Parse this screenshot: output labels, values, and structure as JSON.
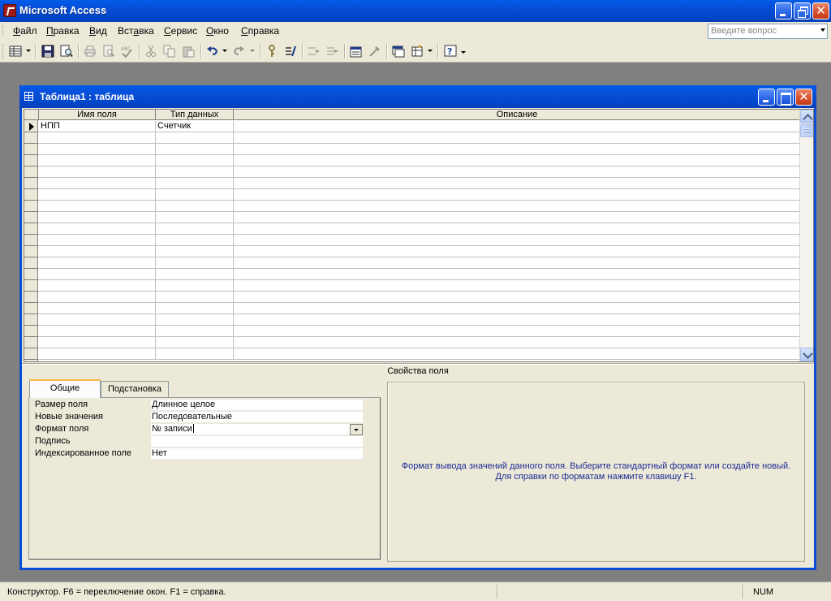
{
  "window": {
    "title": "Microsoft Access"
  },
  "menu": {
    "items": [
      {
        "label": "Файл",
        "accel": "Ф",
        "rest": "айл"
      },
      {
        "label": "Правка",
        "accel": "П",
        "rest": "равка"
      },
      {
        "label": "Вид",
        "accel": "В",
        "rest": "ид"
      },
      {
        "label": "Вставка",
        "pre": "Вст",
        "accel": "а",
        "rest": "вка"
      },
      {
        "label": "Сервис",
        "accel": "С",
        "rest": "ервис"
      },
      {
        "label": "Окно",
        "accel": "О",
        "rest": "кно"
      },
      {
        "label": "Справка",
        "accel": "С",
        "rest": "правка"
      }
    ],
    "question_placeholder": "Введите вопрос"
  },
  "toolbar": {
    "icons": [
      "view-icon",
      "save-icon",
      "print-preview-icon",
      "print-icon",
      "preview-icon",
      "spelling-icon",
      "cut-icon",
      "copy-icon",
      "paste-icon",
      "undo-icon",
      "redo-icon",
      "primary-key-icon",
      "indexes-icon",
      "insert-rows-icon",
      "delete-rows-icon",
      "properties-icon",
      "build-icon",
      "database-window-icon",
      "new-object-icon",
      "help-icon"
    ]
  },
  "child_window": {
    "title": "Таблица1 : таблица"
  },
  "grid": {
    "columns": [
      "Имя поля",
      "Тип данных",
      "Описание"
    ],
    "rows": [
      {
        "field": "НПП",
        "type": "Счетчик",
        "description": ""
      }
    ],
    "empty_rows": 20
  },
  "properties": {
    "caption": "Свойства поля",
    "tabs": [
      "Общие",
      "Подстановка"
    ],
    "active_tab": "Общие",
    "items": [
      {
        "label": "Размер поля",
        "value": "Длинное целое"
      },
      {
        "label": "Новые значения",
        "value": "Последовательные"
      },
      {
        "label": "Формат поля",
        "value": "№ записи",
        "combo": true
      },
      {
        "label": "Подпись",
        "value": ""
      },
      {
        "label": "Индексированное поле",
        "value": "Нет"
      }
    ],
    "help_line1": "Формат вывода значений данного поля.  Выберите стандартный формат или создайте новый.",
    "help_line2": "Для справки по форматам нажмите клавишу F1."
  },
  "statusbar": {
    "text": "Конструктор.  F6 = переключение окон.  F1 = справка.",
    "num": "NUM"
  },
  "colors": {
    "title_blue": "#0a4ed6",
    "face": "#ece9d8",
    "help_text": "#1c2a94",
    "workspace": "#808080"
  }
}
